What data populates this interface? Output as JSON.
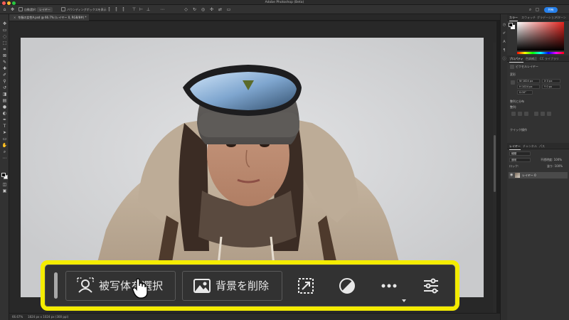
{
  "app": {
    "title": "Adobe Photoshop (Beta)"
  },
  "options_bar": {
    "auto_select_label": "自動選択:",
    "layer_select_value": "レイヤー",
    "transform_controls_label": "バウンディングボックスを表示",
    "share_label": "共有"
  },
  "document": {
    "tab_label": "冬服の女性A.psd @ 66.7% (レイヤー 0, RGB/8#) *"
  },
  "status": {
    "zoom": "66.67%",
    "doc_info": "1824 px x 1024 px (300 ppi)"
  },
  "panels": {
    "color_tabs": [
      "カラー",
      "スウォッチ",
      "グラデーション",
      "パターン"
    ],
    "props_tabs": [
      "プロパティ",
      "色調補正",
      "CC ライブラリ"
    ],
    "pixel_layer_label": "ピクセルレイヤー",
    "transform_section": "変形",
    "width_value": "W  1824 px",
    "x_value": "X  0 px",
    "height_value": "H  1024 px",
    "y_value": "Y  0 px",
    "angle_value": "0.00°",
    "align_section": "整列と分布",
    "align_label": "整列:",
    "quick_actions_section": "クイック操作",
    "layers_tabs": [
      "レイヤー",
      "チャンネル",
      "パス"
    ],
    "search_kind": "種類",
    "blend_mode": "通常",
    "opacity": "不透明度: 100%",
    "lock_label": "ロック:",
    "fill": "塗り: 100%",
    "layer_name": "レイヤー 0"
  },
  "taskbar": {
    "select_subject_label": "被写体を選択",
    "remove_background_label": "背景を削除"
  },
  "icons": {
    "select_subject": "person-select-icon",
    "remove_background": "image-icon",
    "transform_selection": "transform-selection-icon",
    "adjustment": "adjustment-circle-icon",
    "more": "more-dots-icon",
    "settings": "sliders-icon",
    "cursor": "hand-pointer-icon"
  },
  "colors": {
    "highlight": "#f4ec00",
    "accent": "#2680eb"
  }
}
